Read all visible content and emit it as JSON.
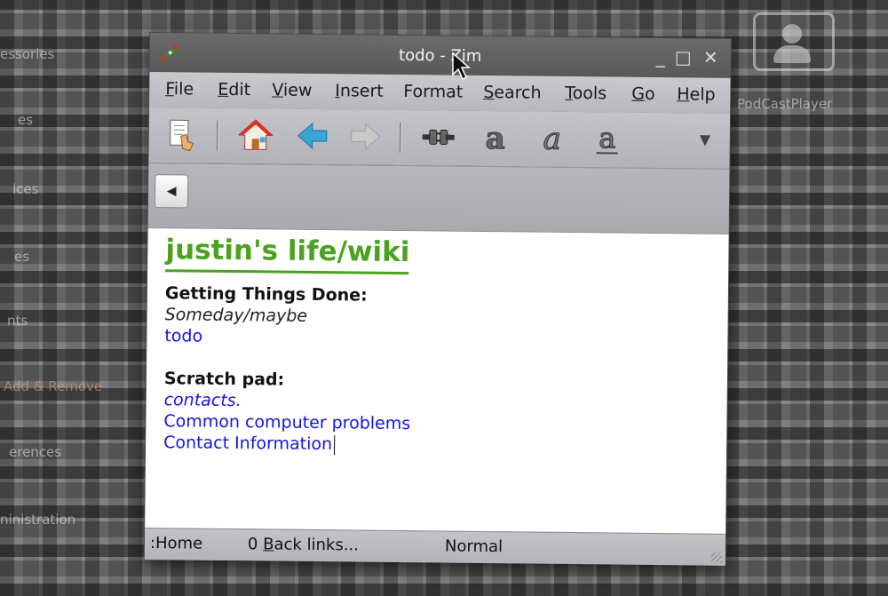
{
  "window": {
    "title": "todo - Zim",
    "controls": [
      "_",
      "□",
      "✕"
    ]
  },
  "menubar": {
    "items": [
      {
        "label": "File",
        "mnemonic": "F",
        "rest": "ile"
      },
      {
        "label": "Edit",
        "mnemonic": "E",
        "rest": "dit"
      },
      {
        "label": "View",
        "mnemonic": "V",
        "rest": "iew"
      },
      {
        "label": "Insert",
        "mnemonic": "I",
        "rest": "nsert"
      },
      {
        "label": "Format",
        "mnemonic": "",
        "rest": "Format"
      },
      {
        "label": "Search",
        "mnemonic": "S",
        "rest": "earch"
      },
      {
        "label": "Tools",
        "mnemonic": "T",
        "rest": "ools"
      },
      {
        "label": "Go",
        "mnemonic": "G",
        "rest": "o"
      },
      {
        "label": "Help",
        "mnemonic": "H",
        "rest": "elp"
      }
    ]
  },
  "toolbar": {
    "icons": [
      "edit-page-icon",
      "home-icon",
      "back-arrow-icon",
      "forward-arrow-icon",
      "link-icon",
      "bold-icon",
      "italic-icon",
      "underline-icon"
    ],
    "overflow": "▼"
  },
  "navbar": {
    "back_glyph": "◀"
  },
  "page": {
    "title": "justin's life/wiki",
    "section1_heading": "Getting Things Done:",
    "someday": "Someday/maybe",
    "todo_link": "todo",
    "section2_heading": "Scratch pad:",
    "contacts_link": "contacts.",
    "problems_link": "Common computer problems",
    "contact_info_link": "Contact Information"
  },
  "statusbar": {
    "page": ":Home",
    "backlinks_count": "0",
    "backlinks_label": "Back links...",
    "backlinks_mnemonic": "B",
    "backlinks_rest": "ack links...",
    "style": "Normal"
  },
  "desktop": {
    "icon_label": "PodCastPlayer",
    "side_labels": [
      "essories",
      "es",
      "ices",
      "es",
      "nts",
      "Add & Remove",
      "erences",
      "ninistration"
    ]
  },
  "colors": {
    "heading_green": "#4aa21e",
    "link_blue": "#1515e6"
  }
}
